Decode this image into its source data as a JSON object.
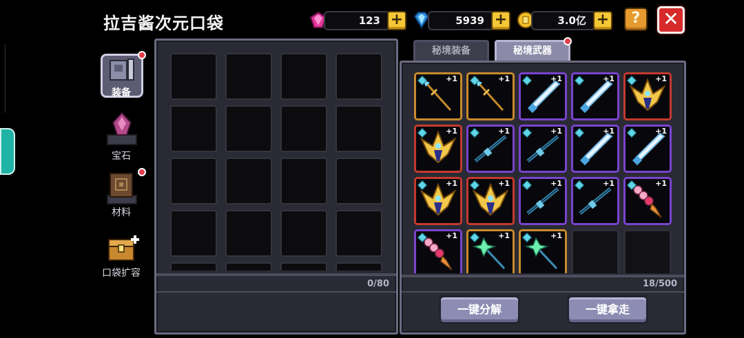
{
  "header": {
    "title": "拉吉酱次元口袋",
    "currencies": [
      {
        "icon": "pink-gem-icon",
        "value": "123"
      },
      {
        "icon": "blue-diamond-icon",
        "value": "5939"
      },
      {
        "icon": "gold-coin-icon",
        "value": "3.0亿"
      }
    ],
    "help_label": "?",
    "close_label": "✕",
    "plus_label": "+"
  },
  "sidebar": {
    "items": [
      {
        "label": "装备",
        "icon": "armor-icon",
        "selected": true,
        "badge": true
      },
      {
        "label": "宝石",
        "icon": "gem-crystal-icon",
        "selected": false,
        "badge": false
      },
      {
        "label": "材料",
        "icon": "material-book-icon",
        "selected": false,
        "badge": true
      },
      {
        "label": "口袋扩容",
        "icon": "treasure-chest-icon",
        "selected": false,
        "badge": false
      }
    ]
  },
  "pocket": {
    "count": "0/80"
  },
  "storage": {
    "tabs": [
      {
        "label": "秘境装备",
        "active": false,
        "badge": false
      },
      {
        "label": "秘境武器",
        "active": true,
        "badge": true
      }
    ],
    "count": "18/500",
    "bonus_label": "+1",
    "items": [
      {
        "weapon": "golden-spear",
        "rarity": "gold"
      },
      {
        "weapon": "golden-spear",
        "rarity": "gold"
      },
      {
        "weapon": "ice-sword",
        "rarity": "purple"
      },
      {
        "weapon": "ice-sword",
        "rarity": "purple"
      },
      {
        "weapon": "golden-wings",
        "rarity": "red"
      },
      {
        "weapon": "golden-wings",
        "rarity": "red"
      },
      {
        "weapon": "rifle",
        "rarity": "purple"
      },
      {
        "weapon": "rifle",
        "rarity": "purple"
      },
      {
        "weapon": "ice-sword",
        "rarity": "purple"
      },
      {
        "weapon": "ice-sword",
        "rarity": "purple"
      },
      {
        "weapon": "golden-wings",
        "rarity": "red"
      },
      {
        "weapon": "golden-wings",
        "rarity": "red"
      },
      {
        "weapon": "rifle",
        "rarity": "purple"
      },
      {
        "weapon": "rifle",
        "rarity": "purple"
      },
      {
        "weapon": "ice-cream-staff",
        "rarity": "purple"
      },
      {
        "weapon": "ice-cream-staff",
        "rarity": "purple"
      },
      {
        "weapon": "green-staff",
        "rarity": "gold"
      },
      {
        "weapon": "green-staff",
        "rarity": "gold"
      },
      {
        "weapon": "empty",
        "rarity": "empty"
      },
      {
        "weapon": "empty",
        "rarity": "empty"
      }
    ],
    "buttons": {
      "decompose_label": "一键分解",
      "take_all_label": "一键拿走"
    }
  },
  "colors": {
    "panel_border": "#6b6b82",
    "rarity_purple": "#7a44ce",
    "rarity_gold": "#c98a2c",
    "rarity_red": "#c43a2e",
    "button": "#8d8cb3",
    "close_red": "#d72a2a",
    "plus_yellow": "#f4c836"
  }
}
